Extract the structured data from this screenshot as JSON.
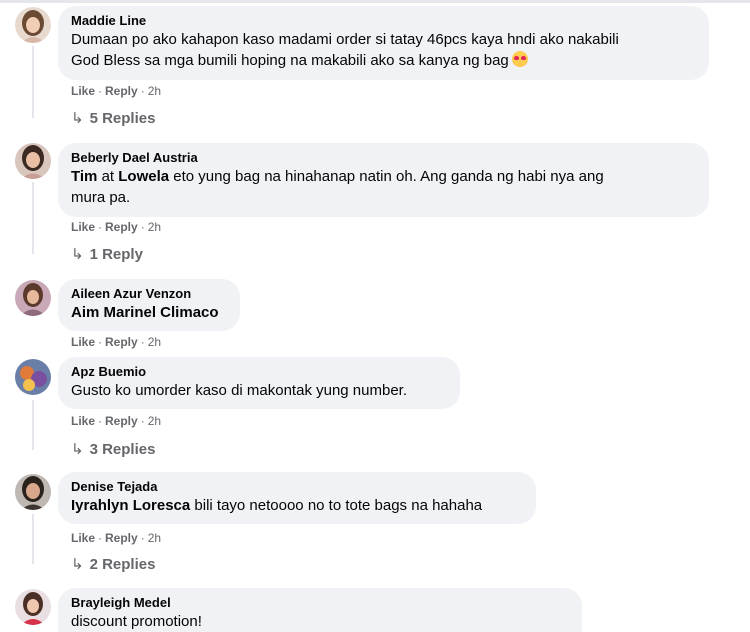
{
  "actions": {
    "like": "Like",
    "reply": "Reply",
    "dot": "·"
  },
  "comments": [
    {
      "author": "Maddie Line",
      "text_line1": "Dumaan po ako kahapon kaso madami order si tatay 46pcs kaya hndi ako nakabili",
      "text_line2": "God Bless sa mga bumili hoping na makabili ako sa kanya ng bag",
      "emoji": "smiling-face-with-hearts",
      "time": "2h",
      "replies": "5 Replies"
    },
    {
      "author": "Beberly Dael Austria",
      "mention1": "Tim",
      "connector": " at ",
      "mention2": "Lowela",
      "text_line1_rest": " eto yung bag na hinahanap natin oh. Ang ganda ng habi nya ang",
      "text_line2": "mura pa.",
      "time": "2h",
      "replies": "1 Reply"
    },
    {
      "author": "Aileen Azur Venzon",
      "mention": "Aim Marinel Climaco",
      "time": "2h"
    },
    {
      "author": "Apz Buemio",
      "text": "Gusto ko umorder kaso di makontak yung number.",
      "time": "2h",
      "replies": "3 Replies"
    },
    {
      "author": "Denise Tejada",
      "mention": "Iyrahlyn Loresca",
      "text_rest": " bili tayo netoooo no to tote bags na hahaha",
      "time": "2h",
      "replies": "2 Replies"
    },
    {
      "author": "Brayleigh Medel",
      "text": "discount promotion!"
    }
  ],
  "colors": {
    "bubble": "#f0f2f5",
    "meta": "#65676b",
    "text": "#050505"
  }
}
